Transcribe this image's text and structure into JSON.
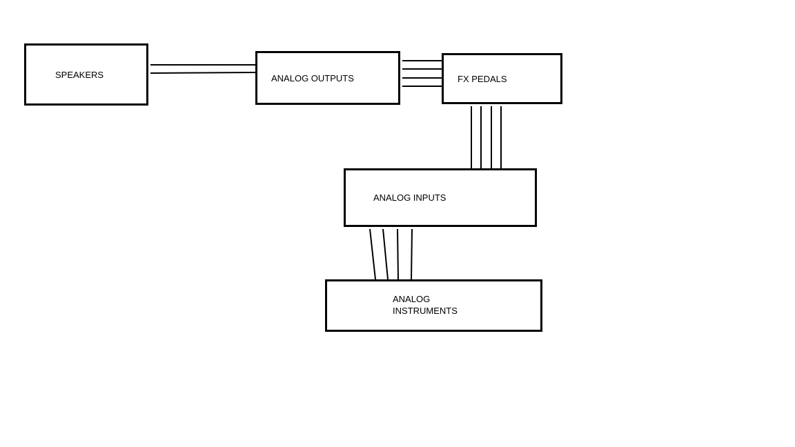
{
  "boxes": {
    "speakers": "SPEAKERS",
    "analog_outputs": "ANALOG OUTPUTS",
    "fx_pedals": "FX PEDALS",
    "analog_inputs": "ANALOG INPUTS",
    "analog_instruments": "ANALOG\nINSTRUMENTS"
  }
}
